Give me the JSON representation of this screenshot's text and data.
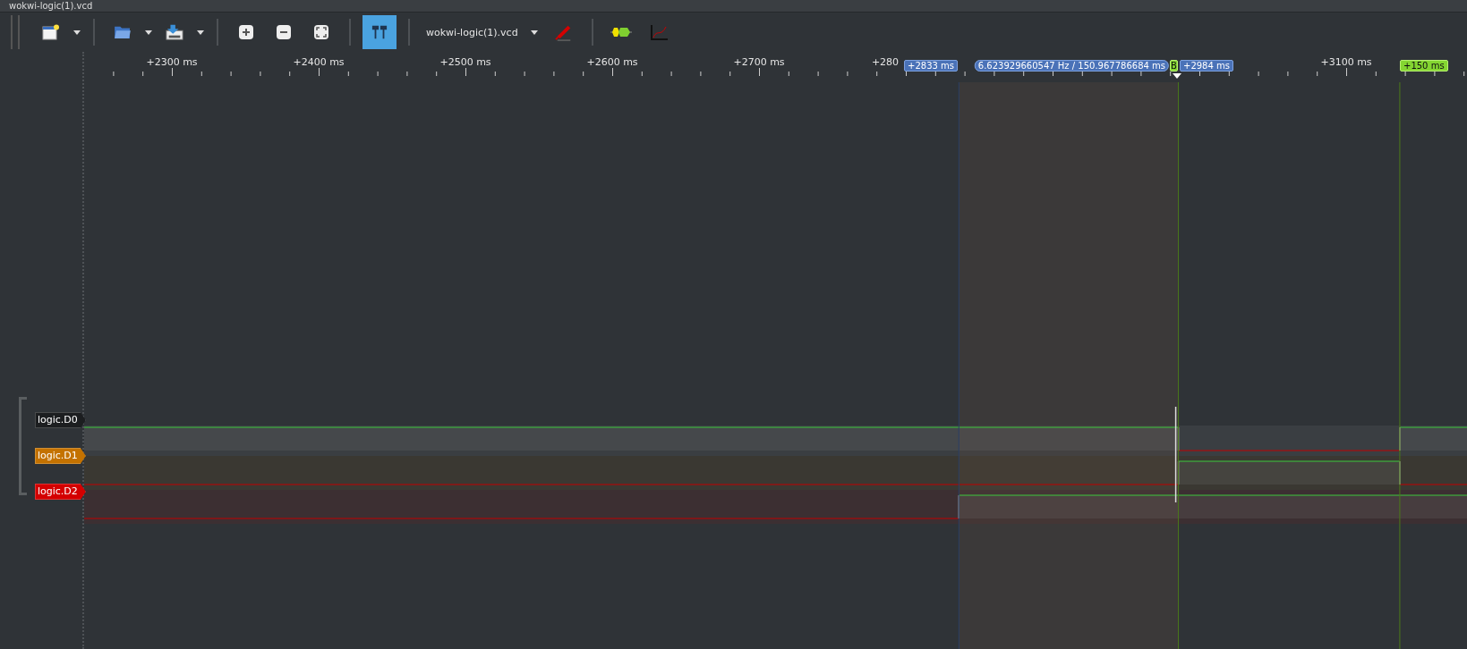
{
  "window": {
    "title": "wokwi-logic(1).vcd"
  },
  "toolbar": {
    "cursors_button": {
      "selected": true
    },
    "device_select": {
      "value": "wokwi-logic(1).vcd"
    }
  },
  "ruler": {
    "labels": [
      "+2300 ms",
      "+2400 ms",
      "+2500 ms",
      "+2600 ms",
      "+2700 ms",
      "+280",
      "+3100 ms"
    ],
    "cursor_start": "+2833 ms",
    "measurement": "6.623929660547 Hz / 150.967786684 ms",
    "cursor_end_tag": "B",
    "cursor_end": "+2984 ms",
    "marker": "+150 ms"
  },
  "signals": [
    {
      "name": "logic.D0",
      "color": "#1c1e20"
    },
    {
      "name": "logic.D1",
      "color": "#c47200"
    },
    {
      "name": "logic.D2",
      "color": "#d40000"
    }
  ]
}
